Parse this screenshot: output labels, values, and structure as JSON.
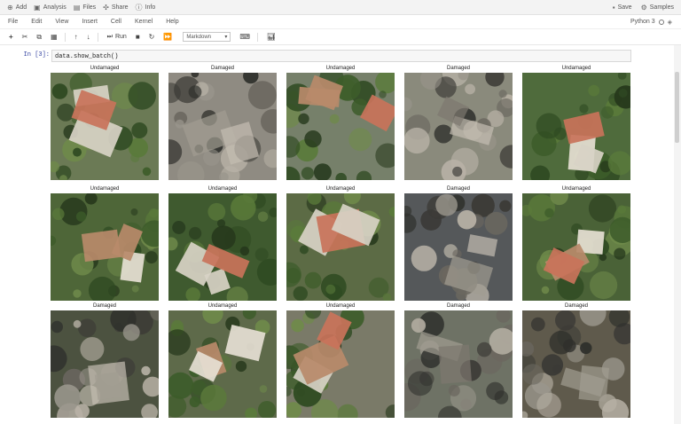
{
  "appbar": {
    "left": [
      {
        "icon": "plus-icon",
        "label": "Add"
      },
      {
        "icon": "analysis-icon",
        "label": "Analysis"
      },
      {
        "icon": "files-icon",
        "label": "Files"
      },
      {
        "icon": "share-icon",
        "label": "Share"
      },
      {
        "icon": "info-icon",
        "label": "Info"
      }
    ],
    "right": [
      {
        "icon": "save-icon",
        "label": "Save"
      },
      {
        "icon": "samples-icon",
        "label": "Samples"
      }
    ]
  },
  "menubar": {
    "items": [
      "File",
      "Edit",
      "View",
      "Insert",
      "Cell",
      "Kernel",
      "Help"
    ],
    "kernel": "Python 3"
  },
  "toolbar": {
    "run_label": "Run",
    "cell_type": "Markdown"
  },
  "cell": {
    "prompt": "In [3]:",
    "code": "data.show_batch()"
  },
  "tiles": [
    {
      "label": "Undamaged",
      "tone": "#6b7a55"
    },
    {
      "label": "Damaged",
      "tone": "#8f8b82"
    },
    {
      "label": "Undamaged",
      "tone": "#76806a"
    },
    {
      "label": "Damaged",
      "tone": "#8a8a7c"
    },
    {
      "label": "Undamaged",
      "tone": "#4f6b3c"
    },
    {
      "label": "Undamaged",
      "tone": "#4e6638"
    },
    {
      "label": "Undamaged",
      "tone": "#3f5a2f"
    },
    {
      "label": "Undamaged",
      "tone": "#5c6b45"
    },
    {
      "label": "Damaged",
      "tone": "#55585a"
    },
    {
      "label": "Undamaged",
      "tone": "#4a6237"
    },
    {
      "label": "Damaged",
      "tone": "#4c5240"
    },
    {
      "label": "Undamaged",
      "tone": "#5e6a4a"
    },
    {
      "label": "Undamaged",
      "tone": "#7a7a68"
    },
    {
      "label": "Damaged",
      "tone": "#6e7265"
    },
    {
      "label": "Damaged",
      "tone": "#5f5a4c"
    }
  ]
}
